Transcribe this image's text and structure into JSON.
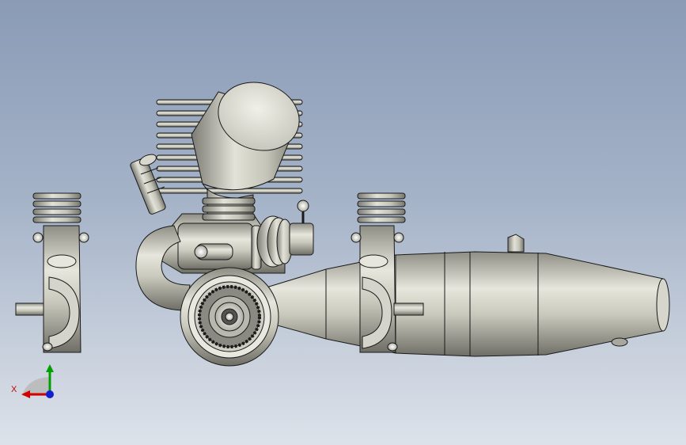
{
  "viewport": {
    "background_top": "#8a9bb6",
    "background_bottom": "#dde2ea",
    "model_color": "#c8c8bc"
  },
  "triad": {
    "x_label": "X",
    "x_color": "#d40000",
    "y_color": "#00a000",
    "z_color": "#1020d0"
  }
}
